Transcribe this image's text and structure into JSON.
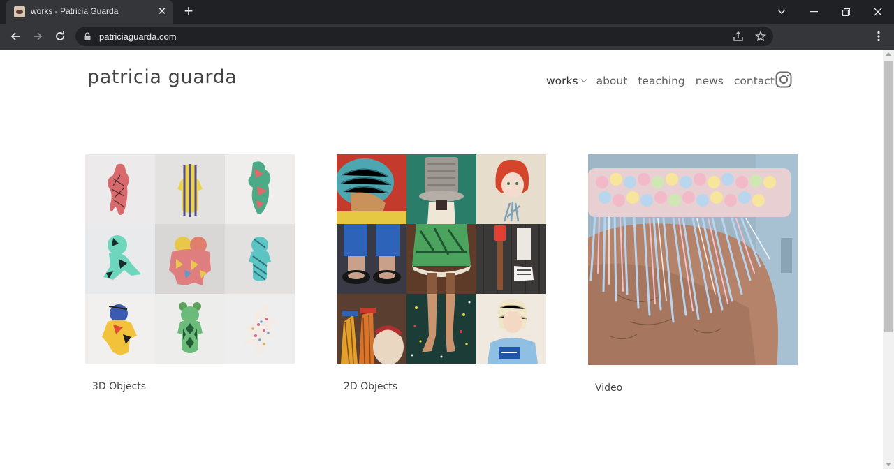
{
  "browser": {
    "tab_title": "works - Patricia Guarda",
    "url": "patriciaguarda.com"
  },
  "site": {
    "title": "patricia guarda",
    "nav": [
      {
        "label": "works",
        "active": true,
        "has_dropdown": true
      },
      {
        "label": "about"
      },
      {
        "label": "teaching"
      },
      {
        "label": "news"
      },
      {
        "label": "contact"
      }
    ],
    "social_icon": "instagram-icon"
  },
  "works": [
    {
      "caption": "3D Objects",
      "image": "grid of nine patterned soft doll figures"
    },
    {
      "caption": "2D Objects",
      "image": "grid of nine embroidered textile panels"
    },
    {
      "caption": "Video",
      "image": "woven pastel yarn collar with fringe on a shoulder"
    }
  ],
  "colors": {
    "chrome_dark": "#202124",
    "chrome_toolbar": "#35363a",
    "page_bg": "#ffffff",
    "text": "#444444"
  }
}
